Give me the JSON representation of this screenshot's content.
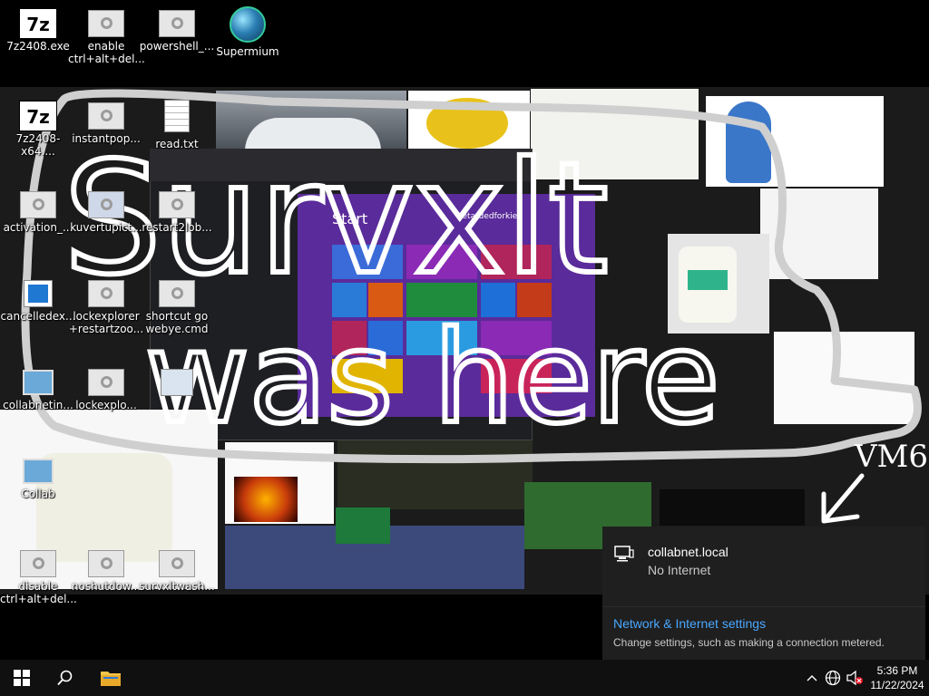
{
  "desktop_icons": [
    {
      "id": "7z2408",
      "label": "7z2408.exe",
      "type": "7zip"
    },
    {
      "id": "enable-cad",
      "label": "enable\nctrl+alt+del...",
      "type": "generic"
    },
    {
      "id": "powershell",
      "label": "powershell_...",
      "type": "generic"
    },
    {
      "id": "supermium",
      "label": "Supermium",
      "type": "globe"
    },
    {
      "id": "7z2408-x64",
      "label": "7z2408-x64....",
      "type": "7zip"
    },
    {
      "id": "instantpop",
      "label": "instantpop...",
      "type": "generic"
    },
    {
      "id": "read-txt",
      "label": "read.txt",
      "type": "text"
    },
    {
      "id": "activation",
      "label": "activation_...",
      "type": "generic"
    },
    {
      "id": "kuvertupict",
      "label": "kuvertupict...",
      "type": "image"
    },
    {
      "id": "restart2lob",
      "label": "restart2lob...",
      "type": "generic"
    },
    {
      "id": "cancelledex",
      "label": "cancelledex...",
      "type": "blue"
    },
    {
      "id": "lockexplorer",
      "label": "lockexplorer\n+restartzoo...",
      "type": "generic"
    },
    {
      "id": "shortcut-go",
      "label": "shortcut go\nwebye.cmd",
      "type": "generic"
    },
    {
      "id": "collabnetin",
      "label": "collabnetin...",
      "type": "pc"
    },
    {
      "id": "lockexplo",
      "label": "lockexplo...",
      "type": "generic"
    },
    {
      "id": "blank1",
      "label": "",
      "type": "screen"
    },
    {
      "id": "collab",
      "label": "Collab",
      "type": "pc"
    },
    {
      "id": "disable-cad",
      "label": "disable\nctrl+alt+del...",
      "type": "generic"
    },
    {
      "id": "noshutdown",
      "label": "noshutdow...",
      "type": "generic"
    },
    {
      "id": "survxltwash",
      "label": "survxltwash...",
      "type": "generic"
    }
  ],
  "scribble": {
    "line1": "Survxlt",
    "line2": "was here",
    "tag": "VM6"
  },
  "start_screen": {
    "title": "Start",
    "user": "retardedforkie"
  },
  "network_flyout": {
    "network_name": "collabnet.local",
    "network_status": "No Internet",
    "settings_link": "Network & Internet settings",
    "settings_desc": "Change settings, such as making a connection metered."
  },
  "taskbar": {
    "start_icon": "windows-logo-icon",
    "search_icon": "search-icon",
    "explorer_icon": "file-explorer-icon",
    "tray_icons": [
      "chevron-up-icon",
      "network-globe-icon",
      "volume-muted-icon"
    ]
  },
  "clock": {
    "time": "5:36 PM",
    "date": "11/22/2024"
  },
  "colors": {
    "taskbar_bg": "#101010",
    "flyout_bg": "#1f1f1f",
    "link": "#4aa8ff",
    "start_bg": "#5a2b9a"
  }
}
